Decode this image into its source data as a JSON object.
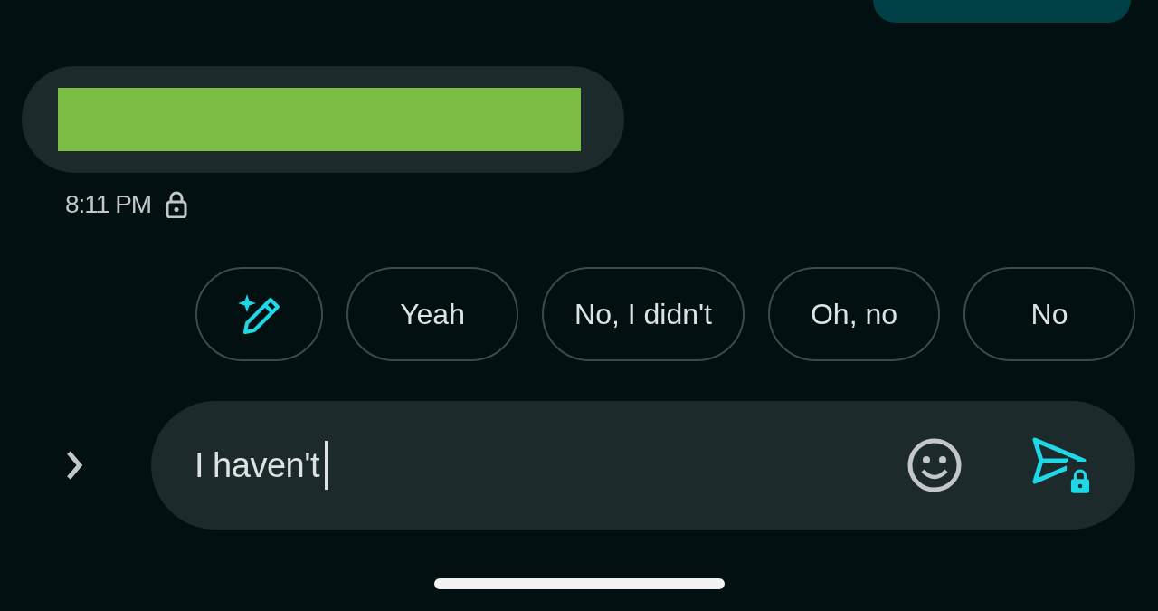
{
  "messages": [
    {
      "kind": "outgoing"
    },
    {
      "kind": "incoming",
      "redacted": true,
      "time": "8:11 PM",
      "encrypted": true
    }
  ],
  "suggestions": [
    {
      "kind": "compose"
    },
    {
      "kind": "reply",
      "label": "Yeah"
    },
    {
      "kind": "reply",
      "label": "No, I didn't"
    },
    {
      "kind": "reply",
      "label": "Oh, no"
    },
    {
      "kind": "reply",
      "label": "No"
    }
  ],
  "composer": {
    "value": "I haven't",
    "encrypted": true
  }
}
